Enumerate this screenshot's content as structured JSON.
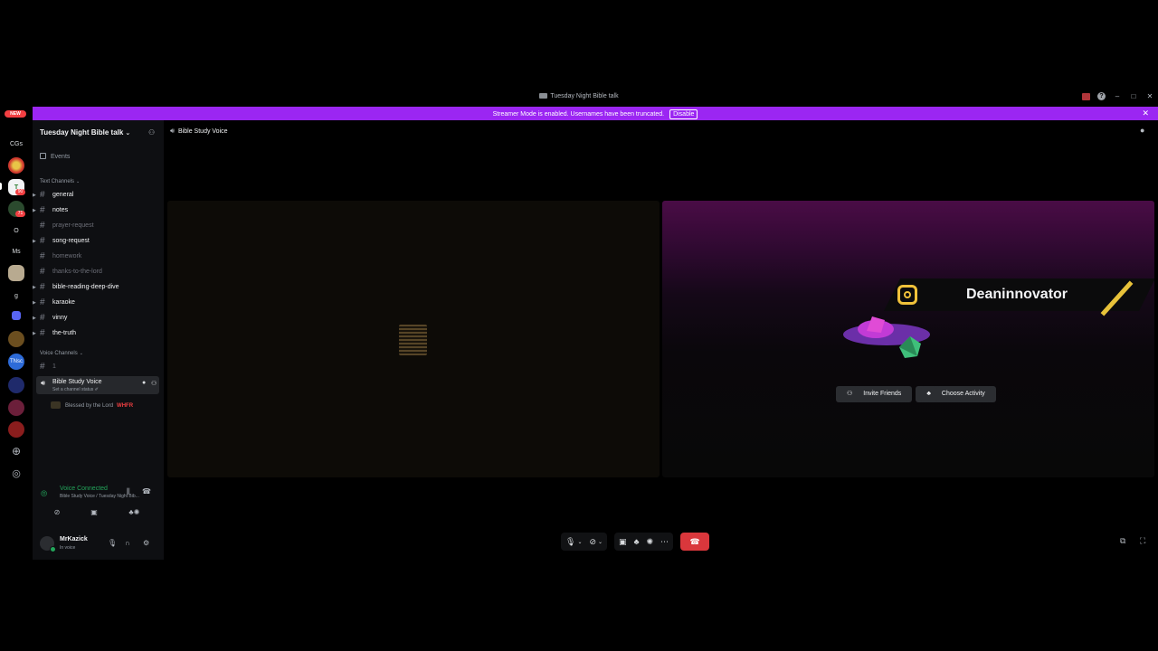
{
  "window": {
    "title": "Tuesday Night Bible talk",
    "controls": [
      "–",
      "□",
      "✕"
    ]
  },
  "banner": {
    "text": "Streamer Mode is enabled. Usernames have been truncated.",
    "button": "Disable",
    "close": "✕"
  },
  "rail": {
    "new_badge": "NEW",
    "labels": [
      "CGs",
      "O",
      "Ms",
      "g",
      "TNsc"
    ],
    "badges": [
      "90",
      "71"
    ]
  },
  "server": {
    "name": "Tuesday Night Bible talk",
    "chevron": "⌄",
    "events": "Events",
    "text_category": "Text Channels",
    "voice_category": "Voice Channels",
    "text_channels": [
      {
        "name": "general"
      },
      {
        "name": "notes"
      },
      {
        "name": "prayer-request"
      },
      {
        "name": "song-request"
      },
      {
        "name": "homework"
      },
      {
        "name": "thanks-to-the-lord"
      },
      {
        "name": "bible-reading-deep-dive"
      },
      {
        "name": "karaoke"
      },
      {
        "name": "vinny"
      },
      {
        "name": "the-truth"
      }
    ],
    "voice_text_channel": "1",
    "voice_channel": {
      "name": "Bible Study Voice",
      "status": "Set a channel status ✐",
      "user": "Blessed by the Lord",
      "user_tag": "WHFR"
    }
  },
  "voice_panel": {
    "title": "Voice Connected",
    "subtitle": "Bible Study Voice / Tuesday Night Bib..."
  },
  "user": {
    "name": "MrKazick",
    "status": "In voice"
  },
  "main": {
    "channel": "Bible Study Voice",
    "stream_handle": "Deaninnovator",
    "invite_button": "Invite Friends",
    "activity_button": "Choose Activity"
  },
  "colors": {
    "accent": "#9b26f2",
    "hangup": "#da373c",
    "connected": "#23a55a"
  }
}
